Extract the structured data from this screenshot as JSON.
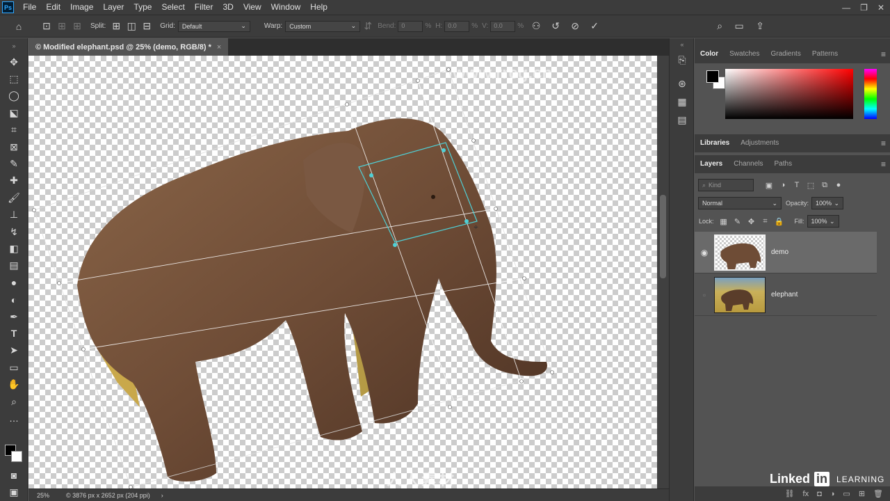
{
  "menubar": {
    "logo": "Ps",
    "items": [
      "File",
      "Edit",
      "Image",
      "Layer",
      "Type",
      "Select",
      "Filter",
      "3D",
      "View",
      "Window",
      "Help"
    ]
  },
  "options": {
    "split_label": "Split:",
    "grid_label": "Grid:",
    "grid_value": "Default",
    "warp_label": "Warp:",
    "warp_value": "Custom",
    "bend_label": "Bend:",
    "bend_value": "0",
    "bend_unit": "%",
    "h_label": "H:",
    "h_value": "0.0",
    "h_unit": "%",
    "v_label": "V:",
    "v_value": "0.0",
    "v_unit": "%"
  },
  "document": {
    "tab_title": "© Modified elephant.psd @ 25% (demo, RGB/8) *",
    "close_glyph": "×"
  },
  "status": {
    "zoom": "25%",
    "info": "© 3876 px x 2652 px (204 ppi)",
    "arrow": "›"
  },
  "panels": {
    "color_tabs": [
      "Color",
      "Swatches",
      "Gradients",
      "Patterns"
    ],
    "lib_tabs": [
      "Libraries",
      "Adjustments"
    ],
    "layer_tabs": [
      "Layers",
      "Channels",
      "Paths"
    ],
    "kind_placeholder": "Kind",
    "blend_mode": "Normal",
    "opacity_label": "Opacity:",
    "opacity_value": "100%",
    "lock_label": "Lock:",
    "fill_label": "Fill:",
    "fill_value": "100%",
    "layers": [
      {
        "name": "demo",
        "visible": true,
        "selected": true
      },
      {
        "name": "elephant",
        "visible": false,
        "selected": false
      }
    ]
  },
  "branding": {
    "linkedin": "Linked",
    "linkedin_in": "in",
    "learning": "LEARNING",
    "watermark_top": "www.rrcg.cn",
    "watermark_center": "人人素材"
  },
  "colors": {
    "foreground": "#000000",
    "background": "#ffffff",
    "warp_grid_selected": "#4fd0d6"
  }
}
